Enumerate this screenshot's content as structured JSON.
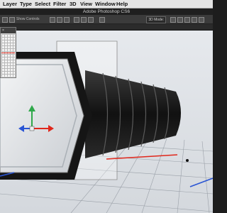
{
  "menubar": {
    "items": [
      {
        "label": "Layer"
      },
      {
        "label": "Type"
      },
      {
        "label": "Select"
      },
      {
        "label": "Filter"
      },
      {
        "label": "3D"
      },
      {
        "label": "View"
      },
      {
        "label": "Window"
      },
      {
        "label": "Help"
      }
    ]
  },
  "window": {
    "title": "Adobe Photoshop CS6"
  },
  "options_bar": {
    "show_label": "Show Controls",
    "mode_badge": "3D Mode:"
  },
  "navigator": {
    "close_glyph": "×"
  },
  "colors": {
    "background": "#dfe3e8",
    "grid": "#9aa0a8",
    "axis_x": "#e0271b",
    "axis_y": "#2fa84a",
    "axis_z": "#2a55d4",
    "object": "#1a1a1a"
  }
}
